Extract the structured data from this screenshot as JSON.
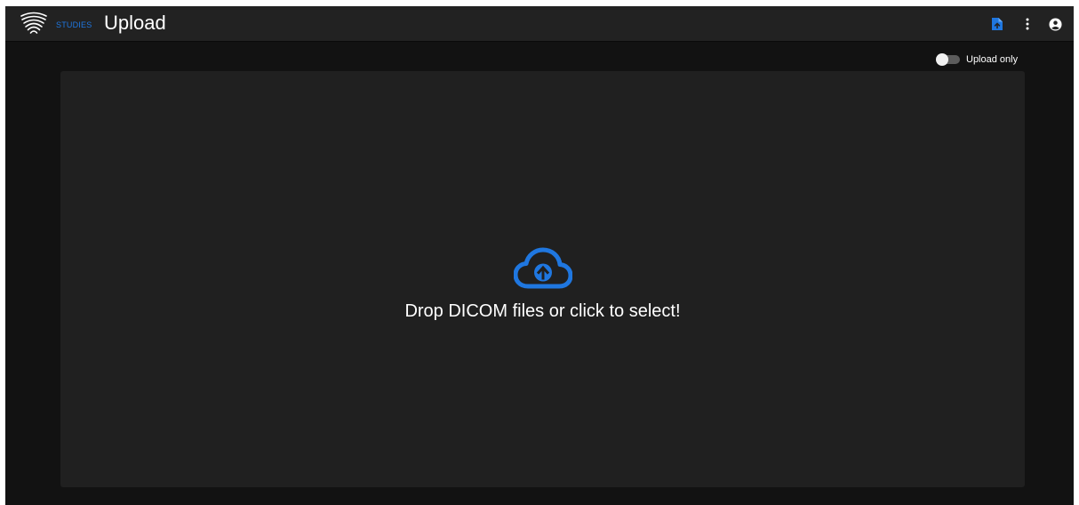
{
  "header": {
    "breadcrumb": "STUDIES",
    "title": "Upload",
    "icons": [
      "logo-icon",
      "upload-file-icon",
      "more-vert-icon",
      "account-circle-icon"
    ]
  },
  "toolbar": {
    "upload_only_label": "Upload only",
    "upload_only_enabled": false
  },
  "dropzone": {
    "icon": "cloud-upload-icon",
    "text": "Drop DICOM files or click to select!"
  },
  "colors": {
    "accent": "#1f77e0",
    "appbar": "#222222",
    "background": "#121212",
    "panel": "#202020",
    "text": "#ffffff"
  }
}
